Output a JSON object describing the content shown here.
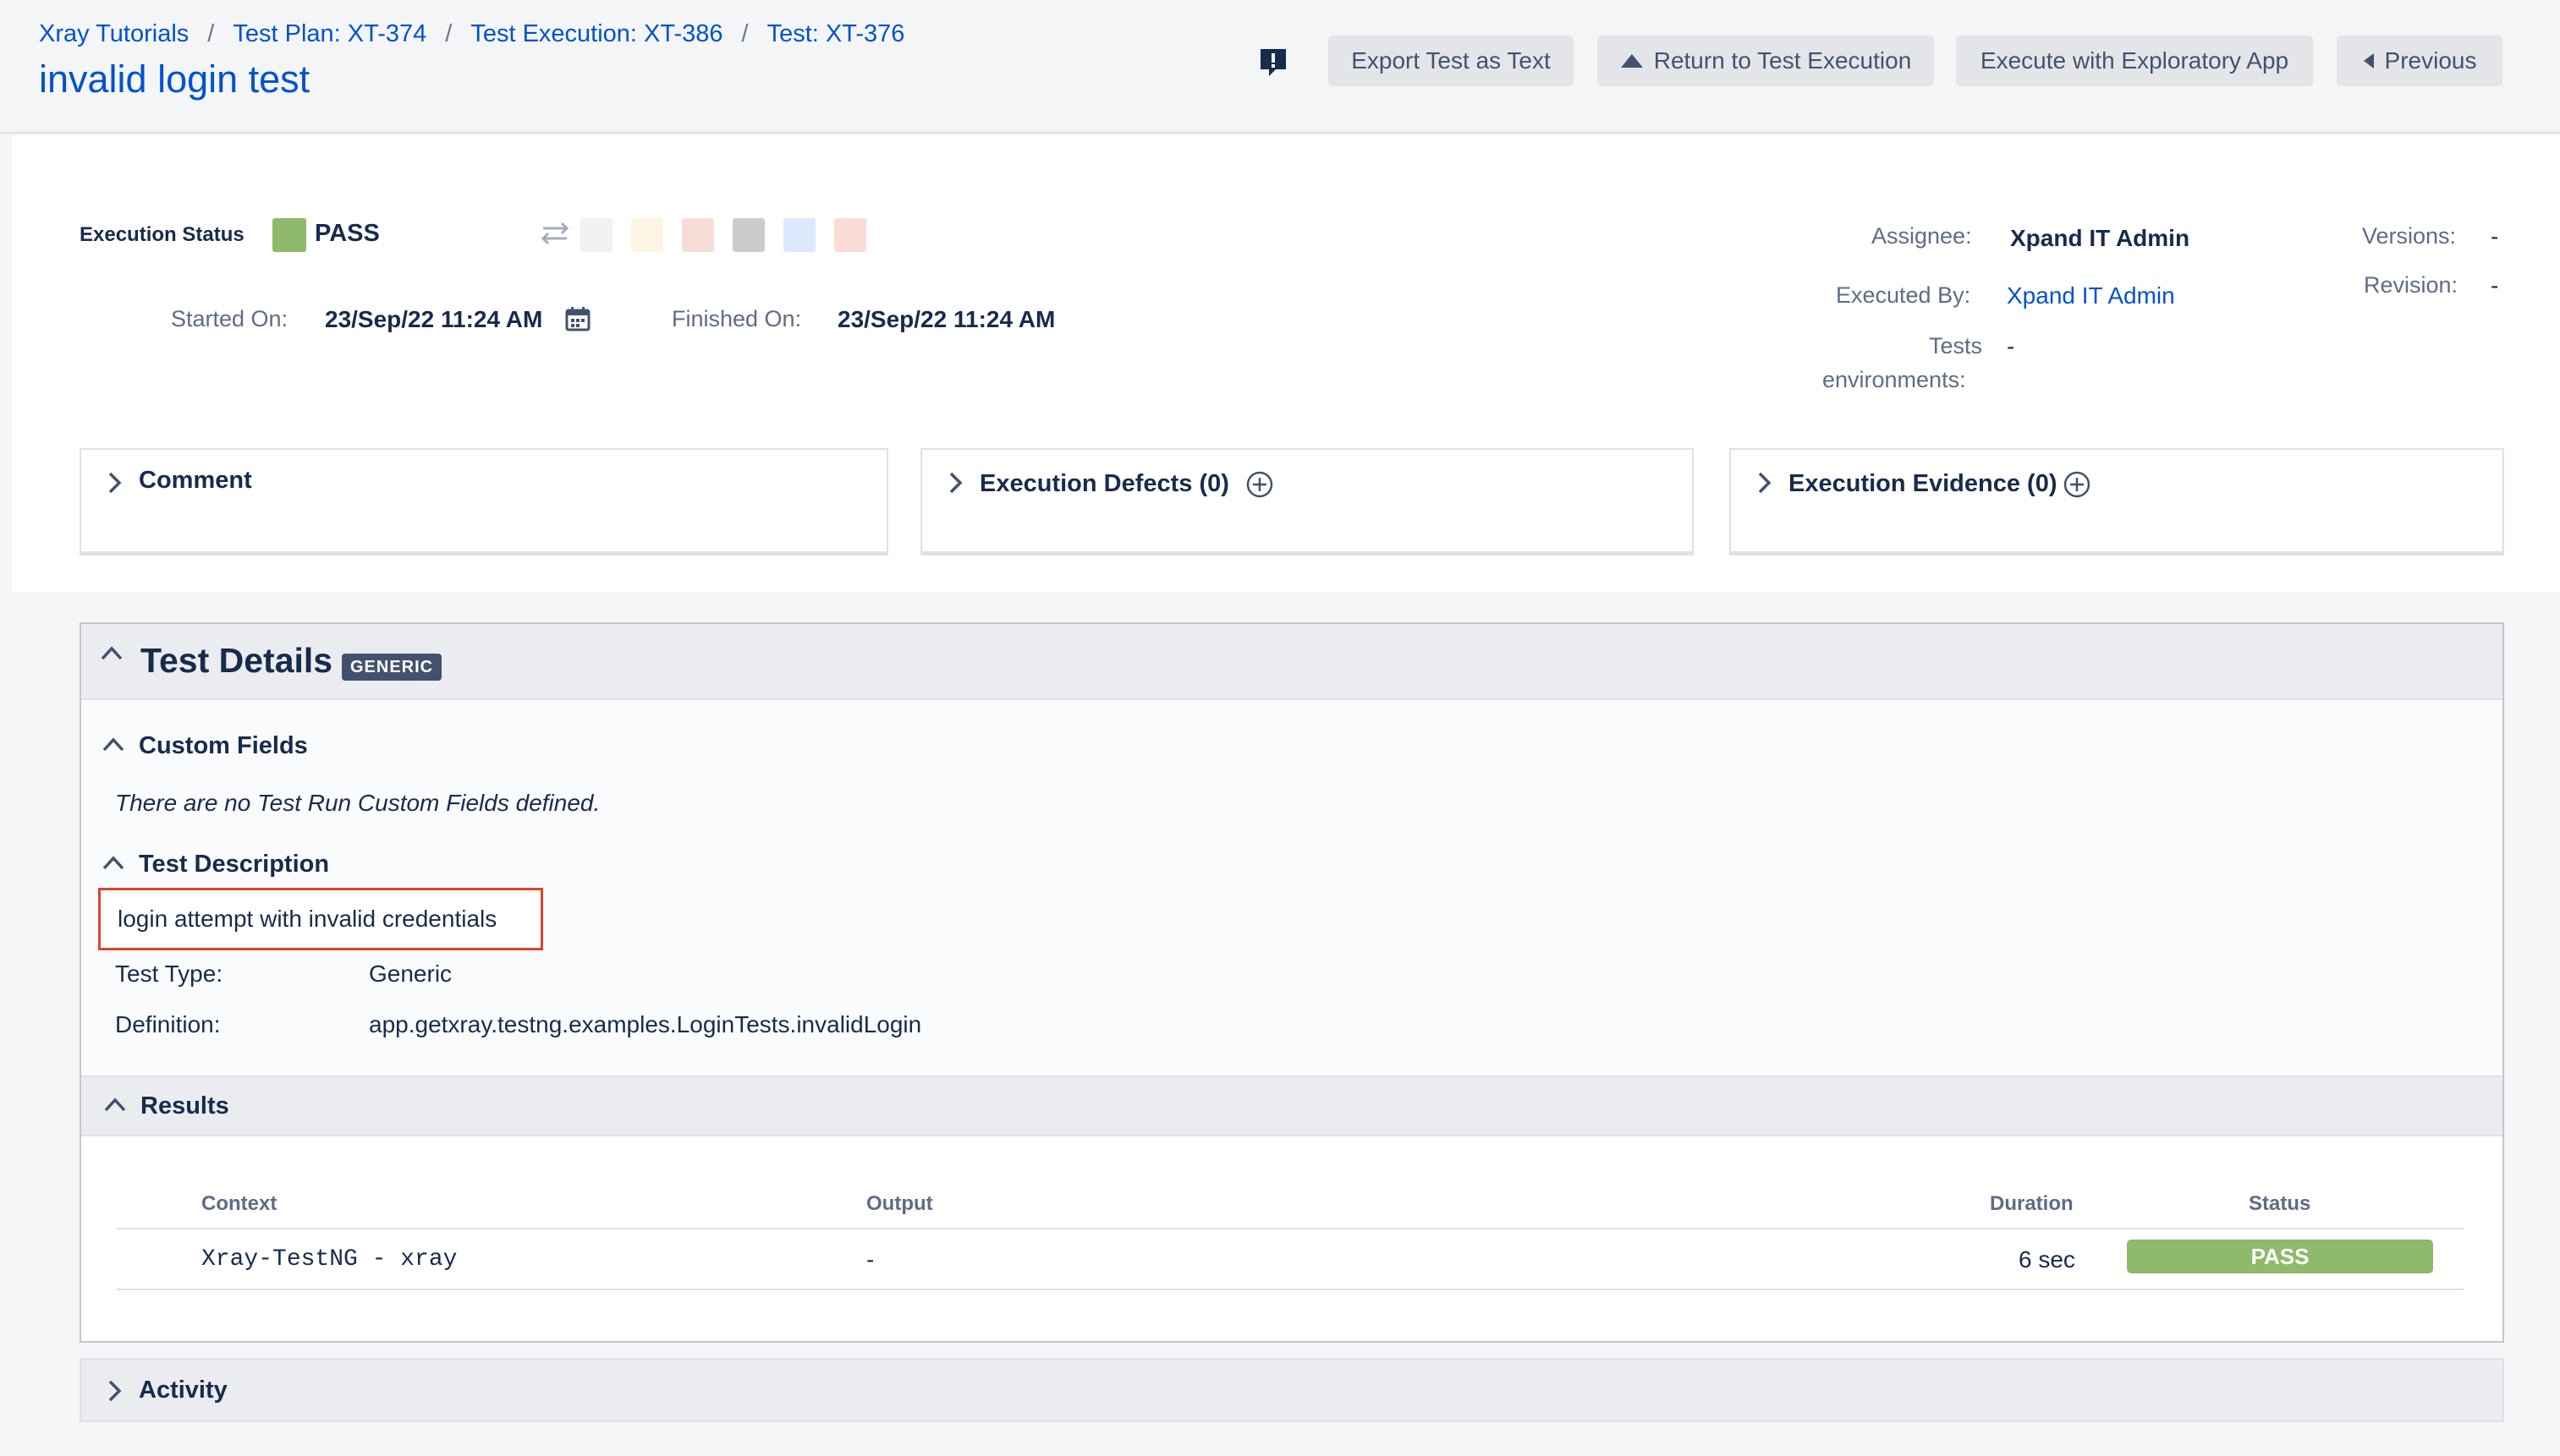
{
  "breadcrumb": {
    "items": [
      "Xray Tutorials",
      "Test Plan: XT-374",
      "Test Execution: XT-386",
      "Test: XT-376"
    ],
    "separator": "/"
  },
  "page_title": "invalid login test",
  "toolbar": {
    "export_label": "Export Test as Text",
    "return_label": "Return to Test Execution",
    "exploratory_label": "Execute with Exploratory App",
    "previous_label": "Previous"
  },
  "execution": {
    "status_label": "Execution Status",
    "status_value": "PASS",
    "status_color": "#8fb96b",
    "status_swatches": [
      "#f0f1f3",
      "#fdf6e4",
      "#f6ddd7",
      "#cacbcd",
      "#dce8fb",
      "#fadcd7"
    ],
    "started_label": "Started On:",
    "started_value": "23/Sep/22 11:24 AM",
    "finished_label": "Finished On:",
    "finished_value": "23/Sep/22 11:24 AM",
    "assignee_label": "Assignee:",
    "assignee_value": "Xpand IT Admin",
    "executed_by_label": "Executed By:",
    "executed_by_value": "Xpand IT Admin",
    "environments_label_1": "Tests",
    "environments_label_2": "environments:",
    "environments_value": "-",
    "versions_label": "Versions:",
    "versions_value": "-",
    "revision_label": "Revision:",
    "revision_value": "-"
  },
  "panels": {
    "comment": "Comment",
    "defects": "Execution Defects (0)",
    "evidence": "Execution Evidence (0)"
  },
  "test_details": {
    "title": "Test Details",
    "badge": "GENERIC",
    "custom_fields_title": "Custom Fields",
    "custom_fields_empty": "There are no Test Run Custom Fields defined.",
    "description_title": "Test Description",
    "description": "login attempt with invalid credentials",
    "type_label": "Test Type:",
    "type_value": "Generic",
    "definition_label": "Definition:",
    "definition_value": "app.getxray.testng.examples.LoginTests.invalidLogin"
  },
  "results": {
    "title": "Results",
    "columns": [
      "Context",
      "Output",
      "Duration",
      "Status"
    ],
    "rows": [
      {
        "context": "Xray-TestNG - xray",
        "output": "-",
        "duration": "6 sec",
        "status": "PASS"
      }
    ]
  },
  "activity": {
    "title": "Activity"
  }
}
